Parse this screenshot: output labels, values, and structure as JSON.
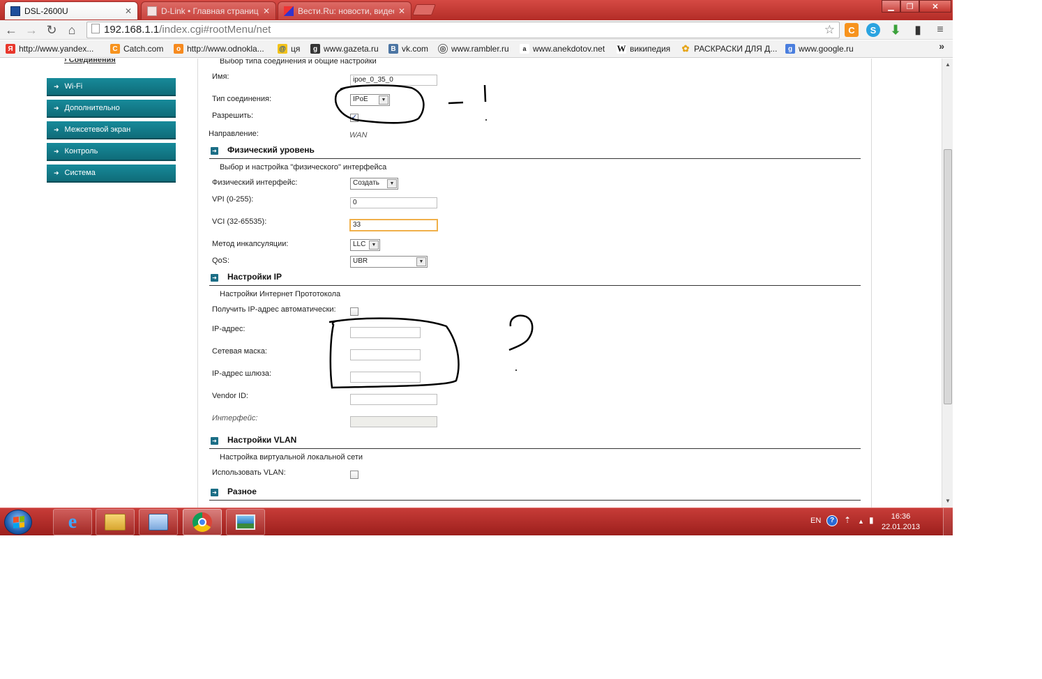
{
  "browser": {
    "tabs": [
      {
        "title": "DSL-2600U",
        "active": true
      },
      {
        "title": "D-Link • Главная страниц",
        "active": false
      },
      {
        "title": "Вести.Ru: новости, видео",
        "active": false
      }
    ],
    "address": {
      "host": "192.168.1.1",
      "path": "/index.cgi#rootMenu/net"
    },
    "bookmarks": [
      {
        "label": "http://www.yandex...",
        "icon": "yandex-icon",
        "color": "#e8372c",
        "glyph": "Я"
      },
      {
        "label": "Catch.com",
        "icon": "catch-icon",
        "color": "#f7931e",
        "glyph": "C"
      },
      {
        "label": "http://www.odnokla...",
        "icon": "odnoklassniki-icon",
        "color": "#f68a1f",
        "glyph": "ok"
      },
      {
        "label": "ця",
        "icon": "mail-at-icon",
        "color": "#1d4fa1",
        "glyph": "@"
      },
      {
        "label": "www.gazeta.ru",
        "icon": "gazeta-icon",
        "color": "#333333",
        "glyph": "g"
      },
      {
        "label": "vk.com",
        "icon": "vk-icon",
        "color": "#4c75a3",
        "glyph": "B"
      },
      {
        "label": "www.rambler.ru",
        "icon": "rambler-icon",
        "color": "#555555",
        "glyph": "◎"
      },
      {
        "label": "www.anekdotov.net",
        "icon": "anekdotov-icon",
        "color": "#444444",
        "glyph": "a"
      },
      {
        "label": "википедия",
        "icon": "wikipedia-icon",
        "color": "#ffffff",
        "glyph": "W"
      },
      {
        "label": "РАСКРАСКИ ДЛЯ Д...",
        "icon": "coloring-icon",
        "color": "#e6a519",
        "glyph": "✿"
      },
      {
        "label": "www.google.ru",
        "icon": "google-icon",
        "color": "#4a7ede",
        "glyph": "g"
      }
    ],
    "bookmarks_more": "»"
  },
  "sidebar": {
    "sub_item": "Соединения",
    "items": [
      {
        "label": "Wi-Fi"
      },
      {
        "label": "Дополнительно"
      },
      {
        "label": "Межсетевой экран"
      },
      {
        "label": "Контроль"
      },
      {
        "label": "Система"
      }
    ]
  },
  "general": {
    "heading_desc": "Выбор типа соединения и общие настройки",
    "name_label": "Имя:",
    "name_value": "ipoe_0_35_0",
    "conn_type_label": "Тип соединения:",
    "conn_type_value": "IPoE",
    "enable_label": "Разрешить:",
    "enable_checked": true,
    "direction_label": "Направление:",
    "direction_value": "WAN"
  },
  "physical": {
    "title": "Физический уровень",
    "desc": "Выбор и настройка \"физического\" интерфейса",
    "iface_label": "Физический интерфейс:",
    "iface_value": "Создать",
    "vpi_label": "VPI (0-255):",
    "vpi_value": "0",
    "vci_label": "VCI (32-65535):",
    "vci_value": "33",
    "encap_label": "Метод инкапсуляции:",
    "encap_value": "LLC",
    "qos_label": "QoS:",
    "qos_value": "UBR"
  },
  "ip": {
    "title": "Настройки IP",
    "desc": "Настройки Интернет Прототокола",
    "auto_label": "Получить IP-адрес автоматически:",
    "auto_checked": false,
    "ip_label": "IP-адрес:",
    "ip_value": "",
    "mask_label": "Сетевая маска:",
    "mask_value": "",
    "gw_label": "IP-адрес шлюза:",
    "gw_value": "",
    "vendor_label": "Vendor ID:",
    "vendor_value": "",
    "iface_label": "Интерфейс:",
    "iface_value": ""
  },
  "vlan": {
    "title": "Настройки VLAN",
    "desc": "Настройка виртуальной локальной сети",
    "use_label": "Использовать VLAN:",
    "use_checked": false
  },
  "misc": {
    "title": "Разное"
  },
  "taskbar": {
    "apps": [
      {
        "name": "internet-explorer-icon"
      },
      {
        "name": "explorer-folder-icon"
      },
      {
        "name": "control-panel-icon"
      },
      {
        "name": "chrome-icon"
      },
      {
        "name": "image-viewer-icon"
      }
    ],
    "lang": "EN",
    "time": "16:36",
    "date": "22.01.2013"
  },
  "colors": {
    "theme_red": "#b22b26",
    "menu_teal": "#0f6c79",
    "focus_orange": "#f0b04a"
  }
}
